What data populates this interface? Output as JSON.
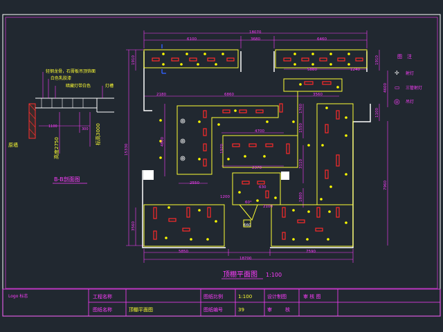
{
  "drawing": {
    "main_title": "顶棚平面图",
    "main_scale": "1:100",
    "section_title": "B-B剖面图"
  },
  "dimensions": {
    "top_total": "18070",
    "top_seg_left": "6100",
    "top_seg_mid": "3680",
    "top_seg_right": "6460",
    "left_total": "15330",
    "left_upper": "1910",
    "left_lower": "3560",
    "right_upper": "1910",
    "right_mid": "4600",
    "right_lower": "7960",
    "right_small": "1100",
    "upper_left": "2180",
    "upper_mid": "6860",
    "upper_right": "3560",
    "ur_a": "5880",
    "ur_b": "1240",
    "inner_4700": "4700",
    "inner_2370": "2370",
    "inner_2550": "2550",
    "inner_1970": "1970",
    "inner_1550": "1550",
    "inner_1760": "1760",
    "inner_3110": "3110",
    "inner_1800": "1800",
    "inner_1200": "1200",
    "inner_2100": "2100",
    "inner_4800": "4800",
    "inner_630": "630",
    "angle_60": "60°",
    "bottom_left": "5850",
    "bottom_right": "7590",
    "bottom_total": "18700",
    "small_660": "660",
    "sec_1100": "1100",
    "sec_3000": "300",
    "sec_h1": "高度2750",
    "sec_h2": "标高3000",
    "sec_wall": "原墙",
    "sec_note1": "轻钢龙骨，石膏板吊顶饰面",
    "sec_note2": "白色乳胶漆",
    "sec_note3": "暗藏灯带白色",
    "sec_note4": "灯槽"
  },
  "legend": {
    "title": "图　注",
    "items": [
      {
        "symbol": "✢",
        "label": "射灯"
      },
      {
        "symbol": "▭",
        "label": "三管射灯"
      },
      {
        "symbol": "◎",
        "label": "吊灯"
      }
    ]
  },
  "title_block": {
    "logo": "Logo 标志",
    "row1": [
      "工程名称",
      "",
      "图纸比例",
      "1:100",
      "设计制图",
      "审 核 图"
    ],
    "row2": [
      "图纸名称",
      "顶棚平面图",
      "图纸编号",
      "39",
      "审",
      "核"
    ]
  },
  "colors": {
    "background": "#212830",
    "wall": "#ffffff",
    "dimension": "#ff3dff",
    "outline": "#ffff33",
    "fixture": "#ff2a2a",
    "light": "#ffff00",
    "title": "#ff3dff"
  }
}
